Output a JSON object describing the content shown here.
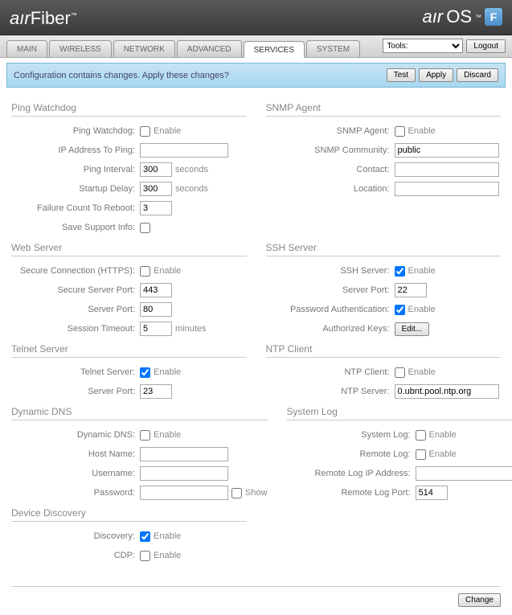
{
  "header": {
    "logo_left_air": "aır",
    "logo_left_fiber": "Fiber",
    "logo_right_air": "aır",
    "logo_right_os": "OS",
    "logo_f": "F",
    "tm": "™"
  },
  "tabs": {
    "main": "MAIN",
    "wireless": "WIRELESS",
    "network": "NETWORK",
    "advanced": "ADVANCED",
    "services": "SERVICES",
    "system": "SYSTEM"
  },
  "toolbar": {
    "tools": "Tools:",
    "logout": "Logout"
  },
  "alert": {
    "msg": "Configuration contains changes. Apply these changes?",
    "test": "Test",
    "apply": "Apply",
    "discard": "Discard"
  },
  "sections": {
    "ping_watchdog": "Ping Watchdog",
    "snmp_agent": "SNMP Agent",
    "web_server": "Web Server",
    "ssh_server": "SSH Server",
    "telnet_server": "Telnet Server",
    "ntp_client": "NTP Client",
    "dynamic_dns": "Dynamic DNS",
    "system_log": "System Log",
    "device_discovery": "Device Discovery"
  },
  "labels": {
    "enable": "Enable",
    "ping_watchdog": "Ping Watchdog:",
    "ip_to_ping": "IP Address To Ping:",
    "ping_interval": "Ping Interval:",
    "startup_delay": "Startup Delay:",
    "failure_count": "Failure Count To Reboot:",
    "save_support": "Save Support Info:",
    "snmp_agent": "SNMP Agent:",
    "snmp_community": "SNMP Community:",
    "contact": "Contact:",
    "location": "Location:",
    "secure_https": "Secure Connection (HTTPS):",
    "secure_port": "Secure Server Port:",
    "server_port": "Server Port:",
    "session_timeout": "Session Timeout:",
    "ssh_server": "SSH Server:",
    "password_auth": "Password Authentication:",
    "authorized_keys": "Authorized Keys:",
    "telnet_server": "Telnet Server:",
    "ntp_client": "NTP Client:",
    "ntp_server": "NTP Server:",
    "dynamic_dns": "Dynamic DNS:",
    "host_name": "Host Name:",
    "username": "Username:",
    "password": "Password:",
    "show": "Show",
    "system_log": "System Log:",
    "remote_log": "Remote Log:",
    "remote_log_ip": "Remote Log IP Address:",
    "remote_log_port": "Remote Log Port:",
    "discovery": "Discovery:",
    "cdp": "CDP:",
    "seconds": "seconds",
    "minutes": "minutes",
    "edit": "Edit...",
    "change": "Change"
  },
  "values": {
    "ping_watchdog_enable": false,
    "ip_to_ping": "",
    "ping_interval": "300",
    "startup_delay": "300",
    "failure_count": "3",
    "save_support": false,
    "snmp_agent_enable": false,
    "snmp_community": "public",
    "contact": "",
    "location": "",
    "https_enable": false,
    "secure_port": "443",
    "web_server_port": "80",
    "session_timeout": "5",
    "ssh_enable": true,
    "ssh_port": "22",
    "password_auth": true,
    "telnet_enable": true,
    "telnet_port": "23",
    "ntp_enable": false,
    "ntp_server": "0.ubnt.pool.ntp.org",
    "ddns_enable": false,
    "host_name": "",
    "username": "",
    "password": "",
    "show_password": false,
    "syslog_enable": false,
    "remote_log_enable": false,
    "remote_log_ip": "",
    "remote_log_port": "514",
    "discovery_enable": true,
    "cdp_enable": false
  }
}
